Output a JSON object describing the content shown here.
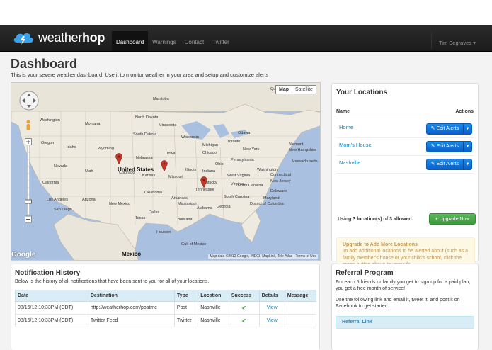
{
  "app": {
    "brand_light": "weather",
    "brand_bold": "hop"
  },
  "nav": {
    "items": [
      "Dashboard",
      "Warnings",
      "Contact",
      "Twitter"
    ],
    "active": "Dashboard",
    "user": "Tim Segraves ▾"
  },
  "page": {
    "title": "Dashboard",
    "subtitle": "This is your severe weather dashboard. Use it to monitor weather in your area and setup and customize alerts"
  },
  "map": {
    "type_map": "Map",
    "type_satellite": "Satellite",
    "attribution": "Map data ©2012 Google, INEGI, MapLink, Tele Atlas - Terms of Use",
    "logo": "Google",
    "country_label": "United States",
    "mexico_label": "Mexico",
    "labels": [
      "Quebec",
      "Manitoba",
      "Washington",
      "North Dakota",
      "Montana",
      "Minnesota",
      "Ottawa",
      "Oregon",
      "South Dakota",
      "Wisconsin",
      "Toronto",
      "Idaho",
      "Wyoming",
      "Michigan",
      "Vermont",
      "Iowa",
      "New Hampshire",
      "Nebraska",
      "Chicago",
      "New York",
      "Nevada",
      "Illinois",
      "Indiana",
      "Ohio",
      "Pennsylvania",
      "Massachusetts",
      "Utah",
      "Colorado",
      "Kansas",
      "Missouri",
      "Connecticut",
      "California",
      "Washington",
      "New Jersey",
      "Los Angeles",
      "Arizona",
      "Oklahoma",
      "Tennessee",
      "Delaware",
      "San Diego",
      "New Mexico",
      "Arkansas",
      "Mississippi",
      "Alabama",
      "Georgia",
      "Maryland",
      "South Carolina",
      "North Carolina",
      "Virginia",
      "Kentucky",
      "Dallas",
      "Texas",
      "Louisiana",
      "Houston",
      "Gulf of Mexico",
      "District of Columbia",
      "West Virginia"
    ],
    "pin_color": "#c0392b"
  },
  "locations": {
    "title": "Your Locations",
    "col_name": "Name",
    "col_actions": "Actions",
    "rows": [
      {
        "name": "Home",
        "action": "Edit Alerts"
      },
      {
        "name": "Mom's House",
        "action": "Edit Alerts"
      },
      {
        "name": "Nashville",
        "action": "Edit Alerts"
      }
    ],
    "usage": "Using 3 location(s) of 3 allowed.",
    "upgrade_button": "+ Upgrade Now",
    "alert_title": "Upgrade to Add More Locations",
    "alert_text": "To add additional locations to be alerted about (such as a family member's house or your child's school, click the green button above to upgrade."
  },
  "notifications": {
    "title": "Notification History",
    "desc": "Below is the history of all notifications that have been sent to you for all of your locations.",
    "headers": [
      "Date",
      "Destination",
      "Type",
      "Location",
      "Success",
      "Details",
      "Message"
    ],
    "rows": [
      {
        "date": "08/16/12 10:33PM (CDT)",
        "destination": "http://weatherhop.com/postme",
        "type": "Post",
        "location": "Nashville",
        "details": "View"
      },
      {
        "date": "08/16/12 10:33PM (CDT)",
        "destination": "Twitter Feed",
        "type": "Twitter",
        "location": "Nashville",
        "details": "View"
      }
    ]
  },
  "referral": {
    "title": "Referral Program",
    "p1": "For each 5 friends or family you get to sign up for a paid plan, you get a free month of service!",
    "p2": "Use the following link and email it, tweet it, and post it on Facebook to get started.",
    "link_label": "Referral Link"
  },
  "colors": {
    "accent": "#0088cc",
    "button_blue": "#0a6ad6",
    "button_green": "#4cae4c",
    "warning_bg": "#fcf8e3",
    "warning_text": "#c09853",
    "table_header": "#d9edf7"
  }
}
